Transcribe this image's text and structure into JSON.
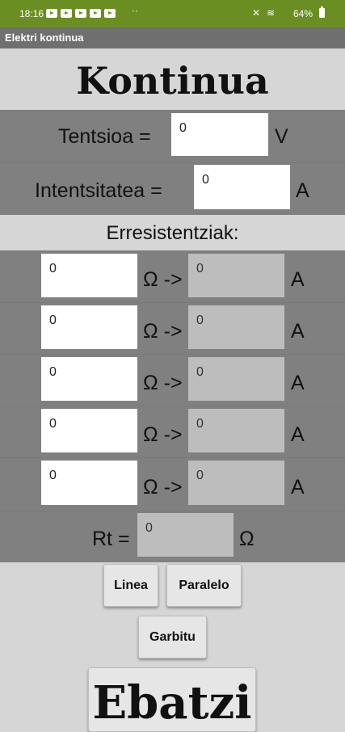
{
  "status_bar": {
    "time": "18:16",
    "overflow_dots": "··",
    "battery": "64%"
  },
  "app": {
    "title": "Elektri kontinua"
  },
  "heading": "Kontinua",
  "voltage": {
    "label": "Tentsioa =",
    "value": "0",
    "unit": "V"
  },
  "current": {
    "label": "Intentsitatea =",
    "value": "0",
    "unit": "A"
  },
  "resistors": {
    "title": "Erresistentziak:",
    "arrow_label": "Ω ->",
    "unit": "A",
    "rows": [
      {
        "resistance": "0",
        "current": "0"
      },
      {
        "resistance": "0",
        "current": "0"
      },
      {
        "resistance": "0",
        "current": "0"
      },
      {
        "resistance": "0",
        "current": "0"
      },
      {
        "resistance": "0",
        "current": "0"
      }
    ]
  },
  "total": {
    "label": "Rt =",
    "value": "0",
    "unit": "Ω"
  },
  "buttons": {
    "series": "Linea",
    "parallel": "Paralelo",
    "clear": "Garbitu",
    "solve": "Ebatzi"
  }
}
